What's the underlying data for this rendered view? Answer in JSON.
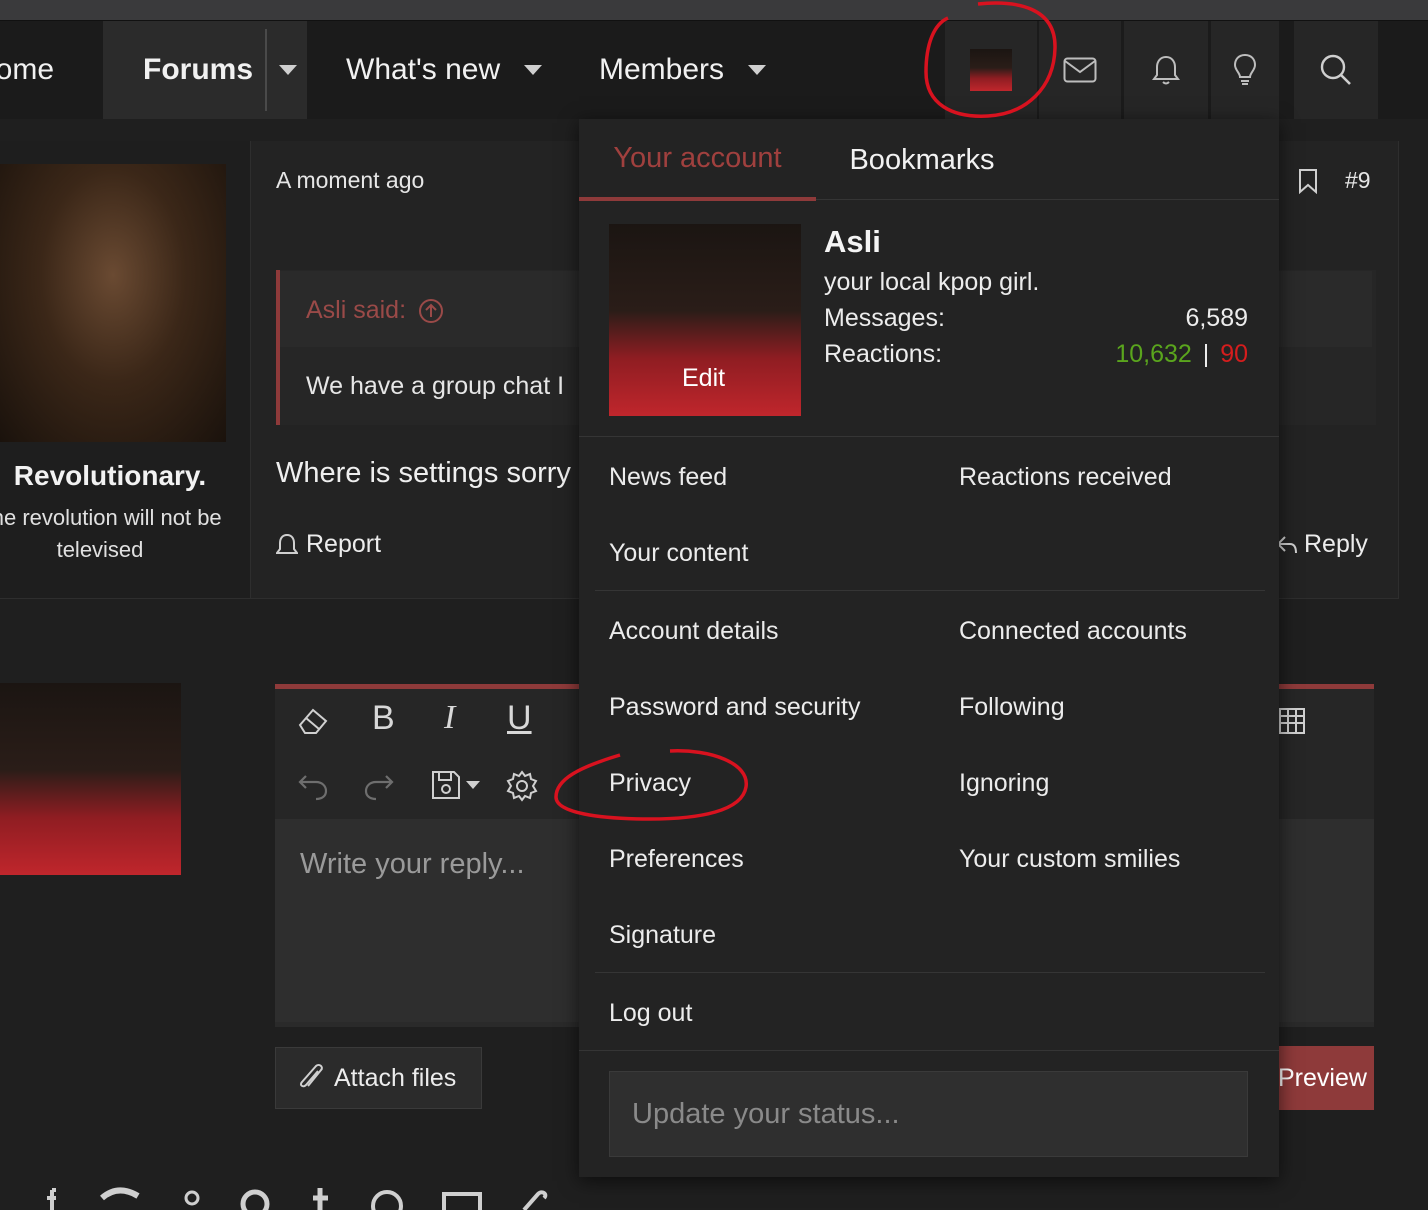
{
  "nav": {
    "home": "Home",
    "forums": "Forums",
    "whats_new": "What's new",
    "members": "Members"
  },
  "post": {
    "time": "A moment ago",
    "number": "#9",
    "author_title": "Revolutionary.",
    "author_tagline_1": "The revolution will not be",
    "author_tagline_2": "televised",
    "quote_author": "Asli said:",
    "quote_text": "We have a group chat I",
    "body": "Where is settings sorry",
    "report": "Report",
    "reply": "Reply"
  },
  "editor": {
    "placeholder": "Write your reply...",
    "attach": "Attach files",
    "preview": "Preview"
  },
  "menu": {
    "tabs": [
      "Your account",
      "Bookmarks"
    ],
    "username": "Asli",
    "user_title": "your local kpop girl.",
    "messages_label": "Messages:",
    "messages_value": "6,589",
    "reactions_label": "Reactions:",
    "reactions_positive": "10,632",
    "reactions_sep": "|",
    "reactions_negative": "90",
    "edit": "Edit",
    "links": {
      "news_feed": "News feed",
      "reactions_received": "Reactions received",
      "your_content": "Your content",
      "account_details": "Account details",
      "connected_accounts": "Connected accounts",
      "password_security": "Password and security",
      "following": "Following",
      "privacy": "Privacy",
      "ignoring": "Ignoring",
      "preferences": "Preferences",
      "custom_smilies": "Your custom smilies",
      "signature": "Signature",
      "log_out": "Log out"
    },
    "status_placeholder": "Update your status..."
  },
  "colors": {
    "accent": "#8e3a3a",
    "tab_active": "#a0403e",
    "reaction_positive": "#5aa51d",
    "reaction_negative": "#d51d1d",
    "annotation": "#d8121f"
  }
}
